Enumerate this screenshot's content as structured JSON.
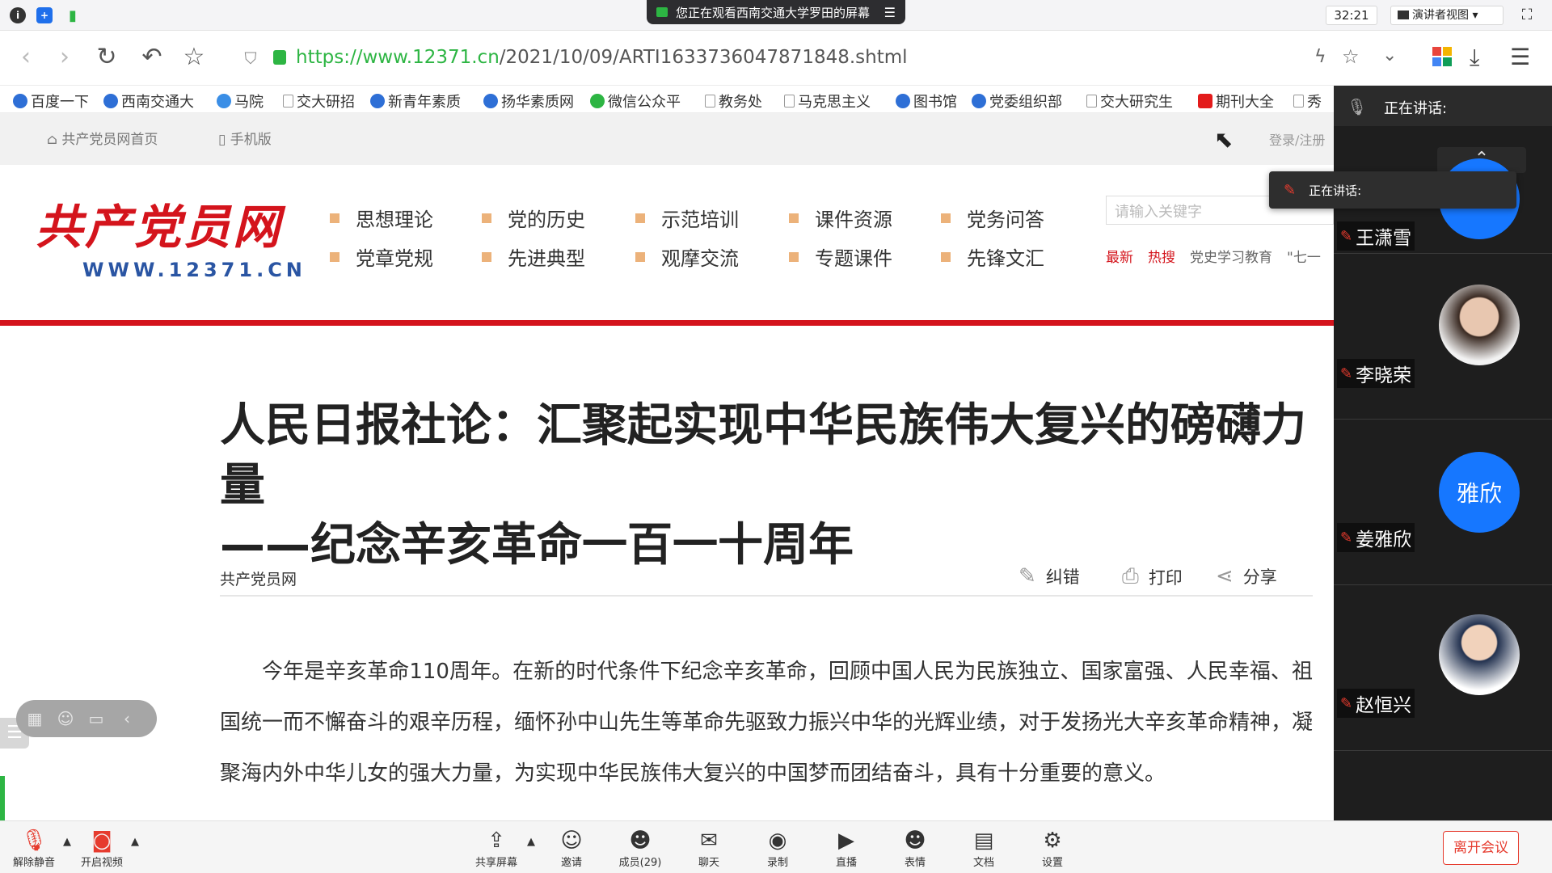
{
  "meeting": {
    "banner": "您正在观看西南交通大学罗田的屏幕",
    "timer": "32:21",
    "view_mode": "演讲者视图",
    "speaking_label": "正在讲话:",
    "popup_label": "正在讲话:",
    "controls": [
      {
        "label": "解除静音",
        "icon": "mic-muted-icon"
      },
      {
        "label": "开启视频",
        "icon": "video-off-icon"
      },
      {
        "label": "共享屏幕",
        "icon": "share-screen-icon"
      },
      {
        "label": "邀请",
        "icon": "invite-icon"
      },
      {
        "label": "成员(29)",
        "icon": "members-icon"
      },
      {
        "label": "聊天",
        "icon": "chat-icon"
      },
      {
        "label": "录制",
        "icon": "record-icon"
      },
      {
        "label": "直播",
        "icon": "live-icon"
      },
      {
        "label": "表情",
        "icon": "emoji-icon"
      },
      {
        "label": "文档",
        "icon": "document-icon"
      },
      {
        "label": "设置",
        "icon": "settings-icon"
      }
    ],
    "leave_label": "离开会议",
    "participants": [
      {
        "name": "王潇雪",
        "avatar": ""
      },
      {
        "name": "李晓荣",
        "avatar": "photo"
      },
      {
        "name": "姜雅欣",
        "avatar": "雅欣"
      },
      {
        "name": "赵恒兴",
        "avatar": "photo"
      }
    ]
  },
  "browser": {
    "url_host": "https://www.12371.cn",
    "url_path": "/2021/10/09/ARTI1633736047871848.shtml",
    "bookmarks": [
      "百度一下",
      "西南交通大",
      "马院",
      "交大研招",
      "新青年素质",
      "扬华素质网",
      "微信公众平",
      "教务处",
      "马克思主义",
      "图书馆",
      "党委组织部",
      "交大研究生",
      "期刊大全",
      "秀"
    ]
  },
  "site": {
    "home_link": "共产党员网首页",
    "mobile_link": "手机版",
    "login_link": "登录/注册",
    "logo_title": "共产党员网",
    "logo_url": "WWW.12371.CN",
    "categories": [
      "思想理论",
      "党的历史",
      "示范培训",
      "课件资源",
      "党务问答",
      "党章党规",
      "先进典型",
      "观摩交流",
      "专题课件",
      "先锋文汇"
    ],
    "search_placeholder": "请输入关键字",
    "hot_latest": "最新",
    "hot_search": "热搜",
    "hot_topic1": "党史学习教育",
    "hot_topic2": "\"七一"
  },
  "article": {
    "title_line1": "人民日报社论：汇聚起实现中华民族伟大复兴的磅礴力量",
    "title_line2": "——纪念辛亥革命一百一十周年",
    "source": "共产党员网",
    "actions": {
      "correct": "纠错",
      "print": "打印",
      "share": "分享"
    },
    "body": "今年是辛亥革命110周年。在新的时代条件下纪念辛亥革命，回顾中国人民为民族独立、国家富强、人民幸福、祖国统一而不懈奋斗的艰辛历程，缅怀孙中山先生等革命先驱致力振兴中华的光辉业绩，对于发扬光大辛亥革命精神，凝聚海内外中华儿女的强大力量，为实现中华民族伟大复兴的中国梦而团结奋斗，具有十分重要的意义。"
  },
  "colors": {
    "accent_green": "#2db543",
    "site_red": "#d4141c",
    "tencent_blue": "#1677ff",
    "leave_red": "#e63b2e"
  }
}
